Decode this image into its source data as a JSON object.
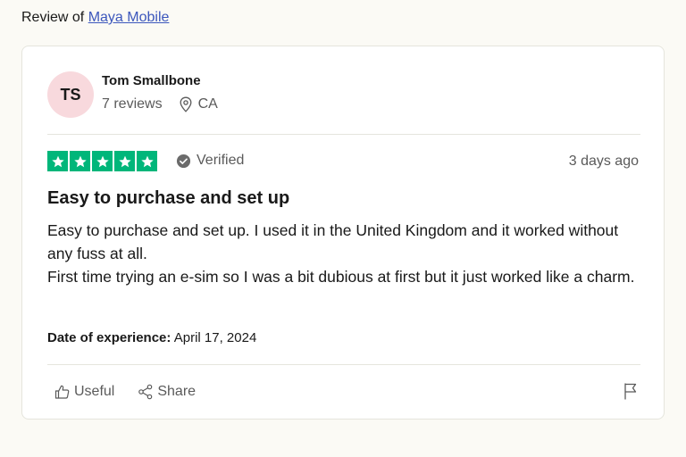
{
  "header": {
    "prefix": "Review of",
    "company_link": "Maya Mobile"
  },
  "reviewer": {
    "initials": "TS",
    "name": "Tom Smallbone",
    "reviews_count": "7 reviews",
    "location": "CA",
    "avatar_color": "#f8d9dd"
  },
  "rating": {
    "stars": 5,
    "max_stars": 5,
    "star_color": "#00b67a",
    "verified_label": "Verified",
    "posted": "3 days ago"
  },
  "review": {
    "title": "Easy to purchase and set up",
    "paragraphs": [
      "Easy to purchase and set up. I used it in the United Kingdom and it worked without any fuss at all.",
      "First time trying an e-sim so I was a bit dubious at first but it just worked like a charm."
    ],
    "experience_label": "Date of experience:",
    "experience_date": "April 17, 2024"
  },
  "actions": {
    "useful_label": "Useful",
    "share_label": "Share"
  },
  "icons": {
    "location": "location-pin-icon",
    "verified": "check-circle-icon",
    "useful": "thumbs-up-icon",
    "share": "share-icon",
    "report": "flag-icon"
  }
}
